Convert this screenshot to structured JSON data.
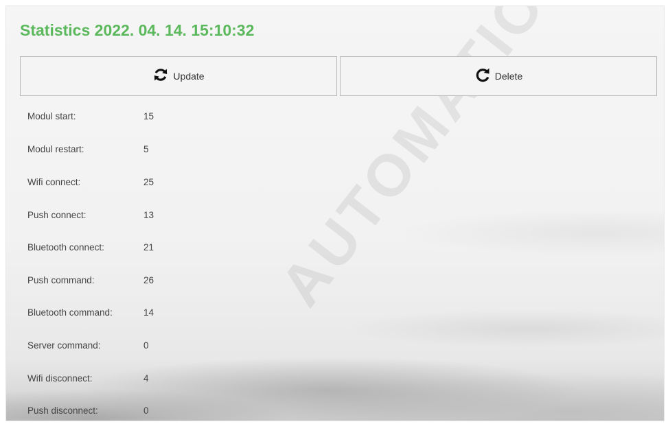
{
  "header": {
    "title": "Statistics 2022. 04. 14. 15:10:32"
  },
  "watermark": {
    "text": "AUTOMATION"
  },
  "toolbar": {
    "update_label": "Update",
    "update_icon": "refresh-icon",
    "delete_label": "Delete",
    "delete_icon": "reset-icon"
  },
  "stats": [
    {
      "label": "Modul start:",
      "value": "15"
    },
    {
      "label": "Modul restart:",
      "value": "5"
    },
    {
      "label": "Wifi connect:",
      "value": "25"
    },
    {
      "label": "Push connect:",
      "value": "13"
    },
    {
      "label": "Bluetooth connect:",
      "value": "21"
    },
    {
      "label": "Push command:",
      "value": "26"
    },
    {
      "label": "Bluetooth command:",
      "value": "14"
    },
    {
      "label": "Server command:",
      "value": "0"
    },
    {
      "label": "Wifi disconnect:",
      "value": "4"
    },
    {
      "label": "Push disconnect:",
      "value": "0"
    }
  ],
  "colors": {
    "title": "#5cb85c",
    "button_bg": "#f4f4f4",
    "button_border": "#b9b9b9"
  }
}
